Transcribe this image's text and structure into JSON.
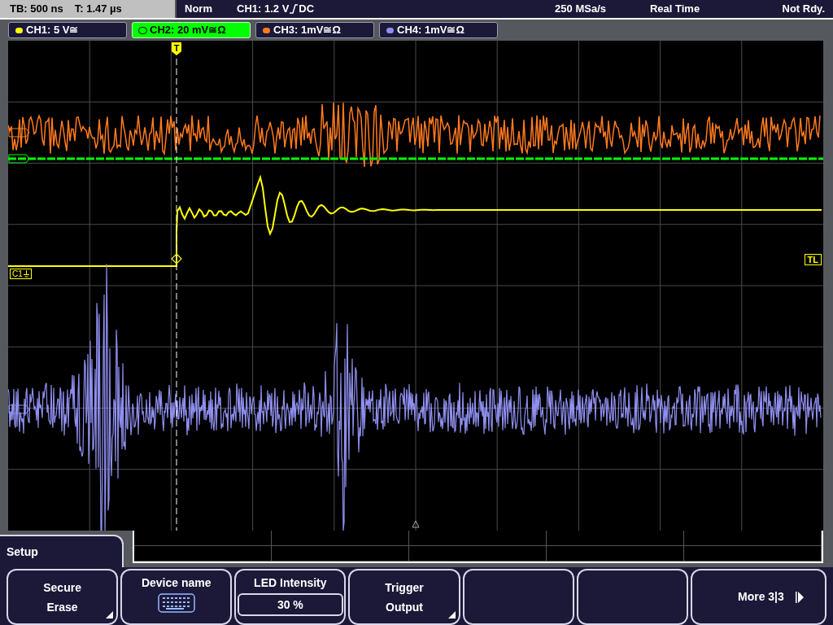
{
  "status_bar": {
    "timebase": "TB: 500 ns",
    "trigger_time": "T: 1.47 µs",
    "mode": "Norm",
    "trigger_source": "CH1: 1.2 V",
    "coupling": "DC",
    "sample_rate": "250 MSa/s",
    "acquisition": "Real Time",
    "state": "Not Rdy."
  },
  "channels": [
    {
      "label": "CH1: 5 V≅",
      "color": "#ffff00",
      "selected": false
    },
    {
      "label": "CH2: 20 mV≅Ω",
      "color": "#00ff00",
      "selected": true
    },
    {
      "label": "CH3: 1mV≅Ω",
      "color": "#ff7a1f",
      "selected": false
    },
    {
      "label": "CH4: 1mV≅Ω",
      "color": "#8f8ff0",
      "selected": false
    }
  ],
  "markers": {
    "trigger": "T",
    "trigger_level": "TL",
    "ch1": "C1"
  },
  "menu": {
    "title": "Setup",
    "softkeys": [
      {
        "kind": "submenu",
        "lines": [
          "Secure",
          "Erase"
        ]
      },
      {
        "kind": "keyboard",
        "label": "Device name"
      },
      {
        "kind": "value",
        "label": "LED Intensity",
        "value": "30 %"
      },
      {
        "kind": "submenu",
        "lines": [
          "Trigger",
          "Output"
        ]
      },
      {
        "kind": "empty"
      },
      {
        "kind": "empty"
      },
      {
        "kind": "next",
        "label": "More 3|3"
      }
    ]
  }
}
